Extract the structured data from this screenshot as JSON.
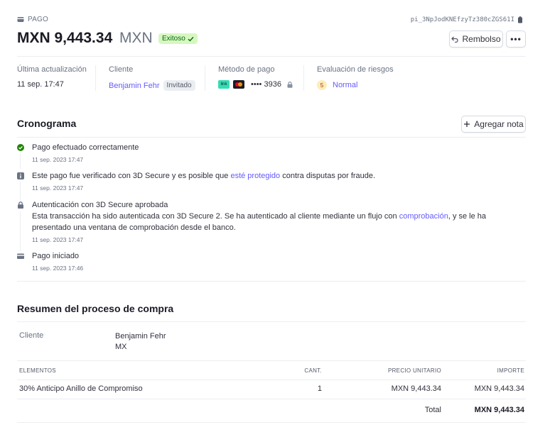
{
  "header": {
    "section_label": "PAGO",
    "payment_id": "pi_3NpJodKNEfzyTz380cZGS61I",
    "amount": "MXN 9,443.34",
    "currency": "MXN",
    "status": "Exitoso",
    "refund_label": "Rembolso",
    "more_label": "•••"
  },
  "meta": {
    "last_update_label": "Última actualización",
    "last_update_value": "11 sep. 17:47",
    "client_label": "Cliente",
    "client_name": "Benjamin Fehr",
    "client_badge": "Invitado",
    "method_label": "Método de pago",
    "card_link_text": "link",
    "card_last4": "•••• 3936",
    "risk_label": "Evaluación de riesgos",
    "risk_score": "5",
    "risk_value": "Normal"
  },
  "timeline": {
    "title": "Cronograma",
    "add_note_label": "Agregar nota",
    "items": [
      {
        "icon": "check-circle-icon",
        "text": "Pago efectuado correctamente",
        "date": "11 sep. 2023 17:47"
      },
      {
        "icon": "info-icon",
        "text_before": "Este pago fue verificado con 3D Secure y es posible que ",
        "link": "esté protegido",
        "text_after": " contra disputas por fraude.",
        "date": "11 sep. 2023 17:47"
      },
      {
        "icon": "lock-icon",
        "title": "Autenticación con 3D Secure aprobada",
        "text_before": "Esta transacción ha sido autenticada con 3D Secure 2. Se ha autenticado al cliente mediante un flujo con ",
        "link": "comprobación",
        "text_after": ", y se le ha presentado una ventana de comprobación desde el banco.",
        "date": "11 sep. 2023 17:47"
      },
      {
        "icon": "card-icon",
        "text": "Pago iniciado",
        "date": "11 sep. 2023 17:46"
      }
    ]
  },
  "summary": {
    "title": "Resumen del proceso de compra",
    "client_label": "Cliente",
    "client_name": "Benjamin Fehr",
    "client_country": "MX",
    "columns": [
      "ELEMENTOS",
      "CANT.",
      "PRECIO UNITARIO",
      "IMPORTE"
    ],
    "rows": [
      {
        "item": "30% Anticipo Anillo de Compromiso",
        "qty": "1",
        "unit_price": "MXN 9,443.34",
        "amount": "MXN 9,443.34"
      }
    ],
    "total_label": "Total",
    "total_value": "MXN 9,443.34"
  },
  "colors": {
    "accent": "#635bff",
    "success": "#05690d",
    "success_bg": "#d7f7c2",
    "text": "#30313d",
    "muted": "#6a7383"
  }
}
